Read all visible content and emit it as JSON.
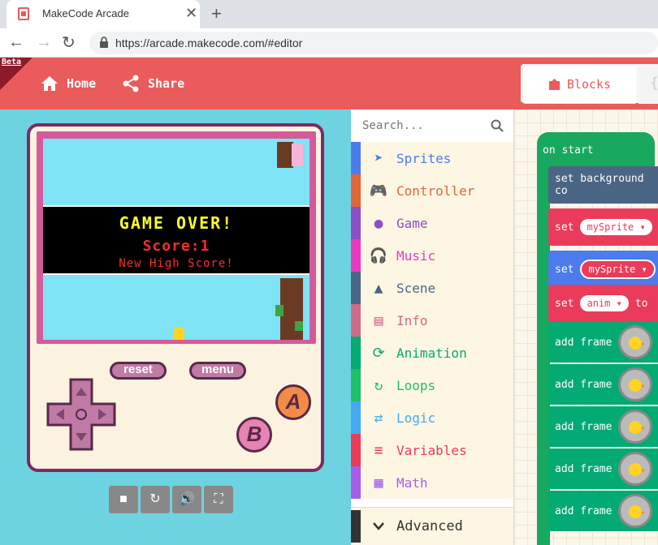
{
  "browser": {
    "tab_title": "MakeCode Arcade",
    "url": "https://arcade.makecode.com/#editor"
  },
  "header": {
    "beta": "Beta",
    "home": "Home",
    "share": "Share",
    "blocks": "Blocks",
    "js_tab": "{"
  },
  "game": {
    "title": "GAME OVER!",
    "score": "Score:1",
    "high_score": "New High Score!"
  },
  "console": {
    "reset": "reset",
    "menu": "menu",
    "a": "A",
    "b": "B"
  },
  "toolbox": {
    "search_placeholder": "Search...",
    "categories": [
      {
        "label": "Sprites",
        "color": "#4b7bec",
        "icon": "paper-plane-icon"
      },
      {
        "label": "Controller",
        "color": "#e4653a",
        "icon": "gamepad-icon"
      },
      {
        "label": "Game",
        "color": "#8e4ec6",
        "icon": "circle-icon"
      },
      {
        "label": "Music",
        "color": "#e63abf",
        "icon": "headphones-icon"
      },
      {
        "label": "Scene",
        "color": "#4b6584",
        "icon": "tree-icon"
      },
      {
        "label": "Info",
        "color": "#cf6a87",
        "icon": "id-card-icon"
      },
      {
        "label": "Animation",
        "color": "#03aa74",
        "icon": "refresh-icon"
      },
      {
        "label": "Loops",
        "color": "#20bf6b",
        "icon": "loop-icon"
      },
      {
        "label": "Logic",
        "color": "#45aaf2",
        "icon": "shuffle-icon"
      },
      {
        "label": "Variables",
        "color": "#eb3b5a",
        "icon": "list-icon"
      },
      {
        "label": "Math",
        "color": "#a55eea",
        "icon": "calculator-icon"
      }
    ],
    "advanced": "Advanced"
  },
  "workspace": {
    "on_start": "on start",
    "set_bg": "set background co",
    "set1": "set",
    "var1": "mySprite ▾",
    "set2": "set",
    "var2": "mySprite ▾",
    "set3": "set",
    "var3": "anim ▾",
    "to": "to",
    "add_frame": "add frame"
  }
}
